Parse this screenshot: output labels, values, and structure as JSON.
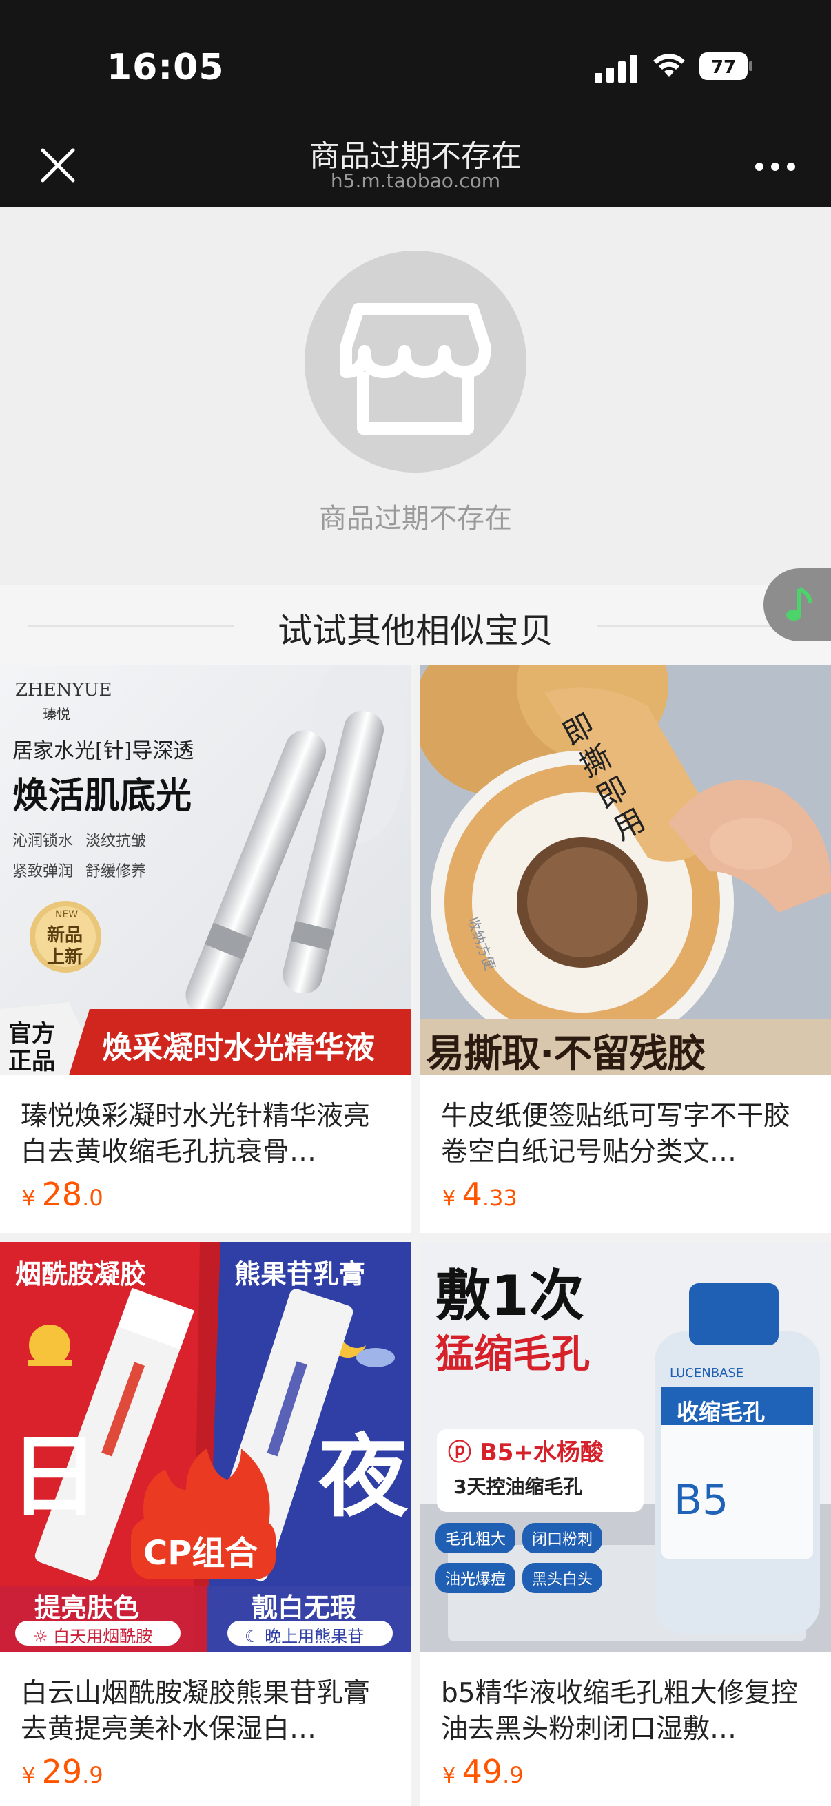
{
  "status": {
    "time": "16:05",
    "battery": "77"
  },
  "nav": {
    "title": "商品过期不存在",
    "url": "h5.m.taobao.com"
  },
  "empty": {
    "message": "商品过期不存在"
  },
  "similar": {
    "title": "试试其他相似宝贝"
  },
  "products": [
    {
      "title": "瑧悦焕彩凝时水光针精华液亮白去黄收缩毛孔抗衰骨…",
      "price_int": "28",
      "price_dec": ".0",
      "img": {
        "brand": "ZHENYUE",
        "brand_cn": "瑧悦",
        "line1": "居家水光[针]导深透",
        "line2": "焕活肌底光",
        "bullets": [
          "沁润锁水",
          "淡纹抗皱",
          "紧致弹润",
          "舒缓修养"
        ],
        "badge_en": "NEW",
        "badge1": "新品",
        "badge2": "上新",
        "corner1": "官方",
        "corner2": "正品",
        "banner": "焕采凝时水光精华液"
      }
    },
    {
      "title": "牛皮纸便签贴纸可写字不干胶卷空白纸记号贴分类文…",
      "price_int": "4",
      "price_dec": ".33",
      "img": {
        "label": [
          "即",
          "撕",
          "即",
          "用"
        ],
        "curve_text": "收纳方便",
        "banner": "易撕取·不留残胶"
      }
    },
    {
      "title": "白云山烟酰胺凝胶熊果苷乳膏去黄提亮美补水保湿白…",
      "price_int": "29",
      "price_dec": ".9",
      "img": {
        "left_head": "烟酰胺凝胶",
        "right_head": "熊果苷乳膏",
        "big_left": "日",
        "big_right": "夜",
        "center": "CP组合",
        "left_foot": "提亮肤色",
        "right_foot": "靓白无瑕",
        "left_tag": "白天用烟酰胺",
        "right_tag": "晚上用熊果苷"
      }
    },
    {
      "title": "b5精华液收缩毛孔粗大修复控油去黑头粉刺闭口湿敷…",
      "price_int": "49",
      "price_dec": ".9",
      "img": {
        "head1": "敷1次",
        "head2": "猛缩毛孔",
        "tag1": "B5+水杨酸",
        "tag2": "3天控油缩毛孔",
        "pills": [
          "毛孔粗大",
          "闭口粉刺",
          "油光爆痘",
          "黑头白头"
        ],
        "bottle_brand": "LUCENBASE",
        "bottle_label": "收缩毛孔",
        "bottle_b5": "B5"
      }
    }
  ]
}
